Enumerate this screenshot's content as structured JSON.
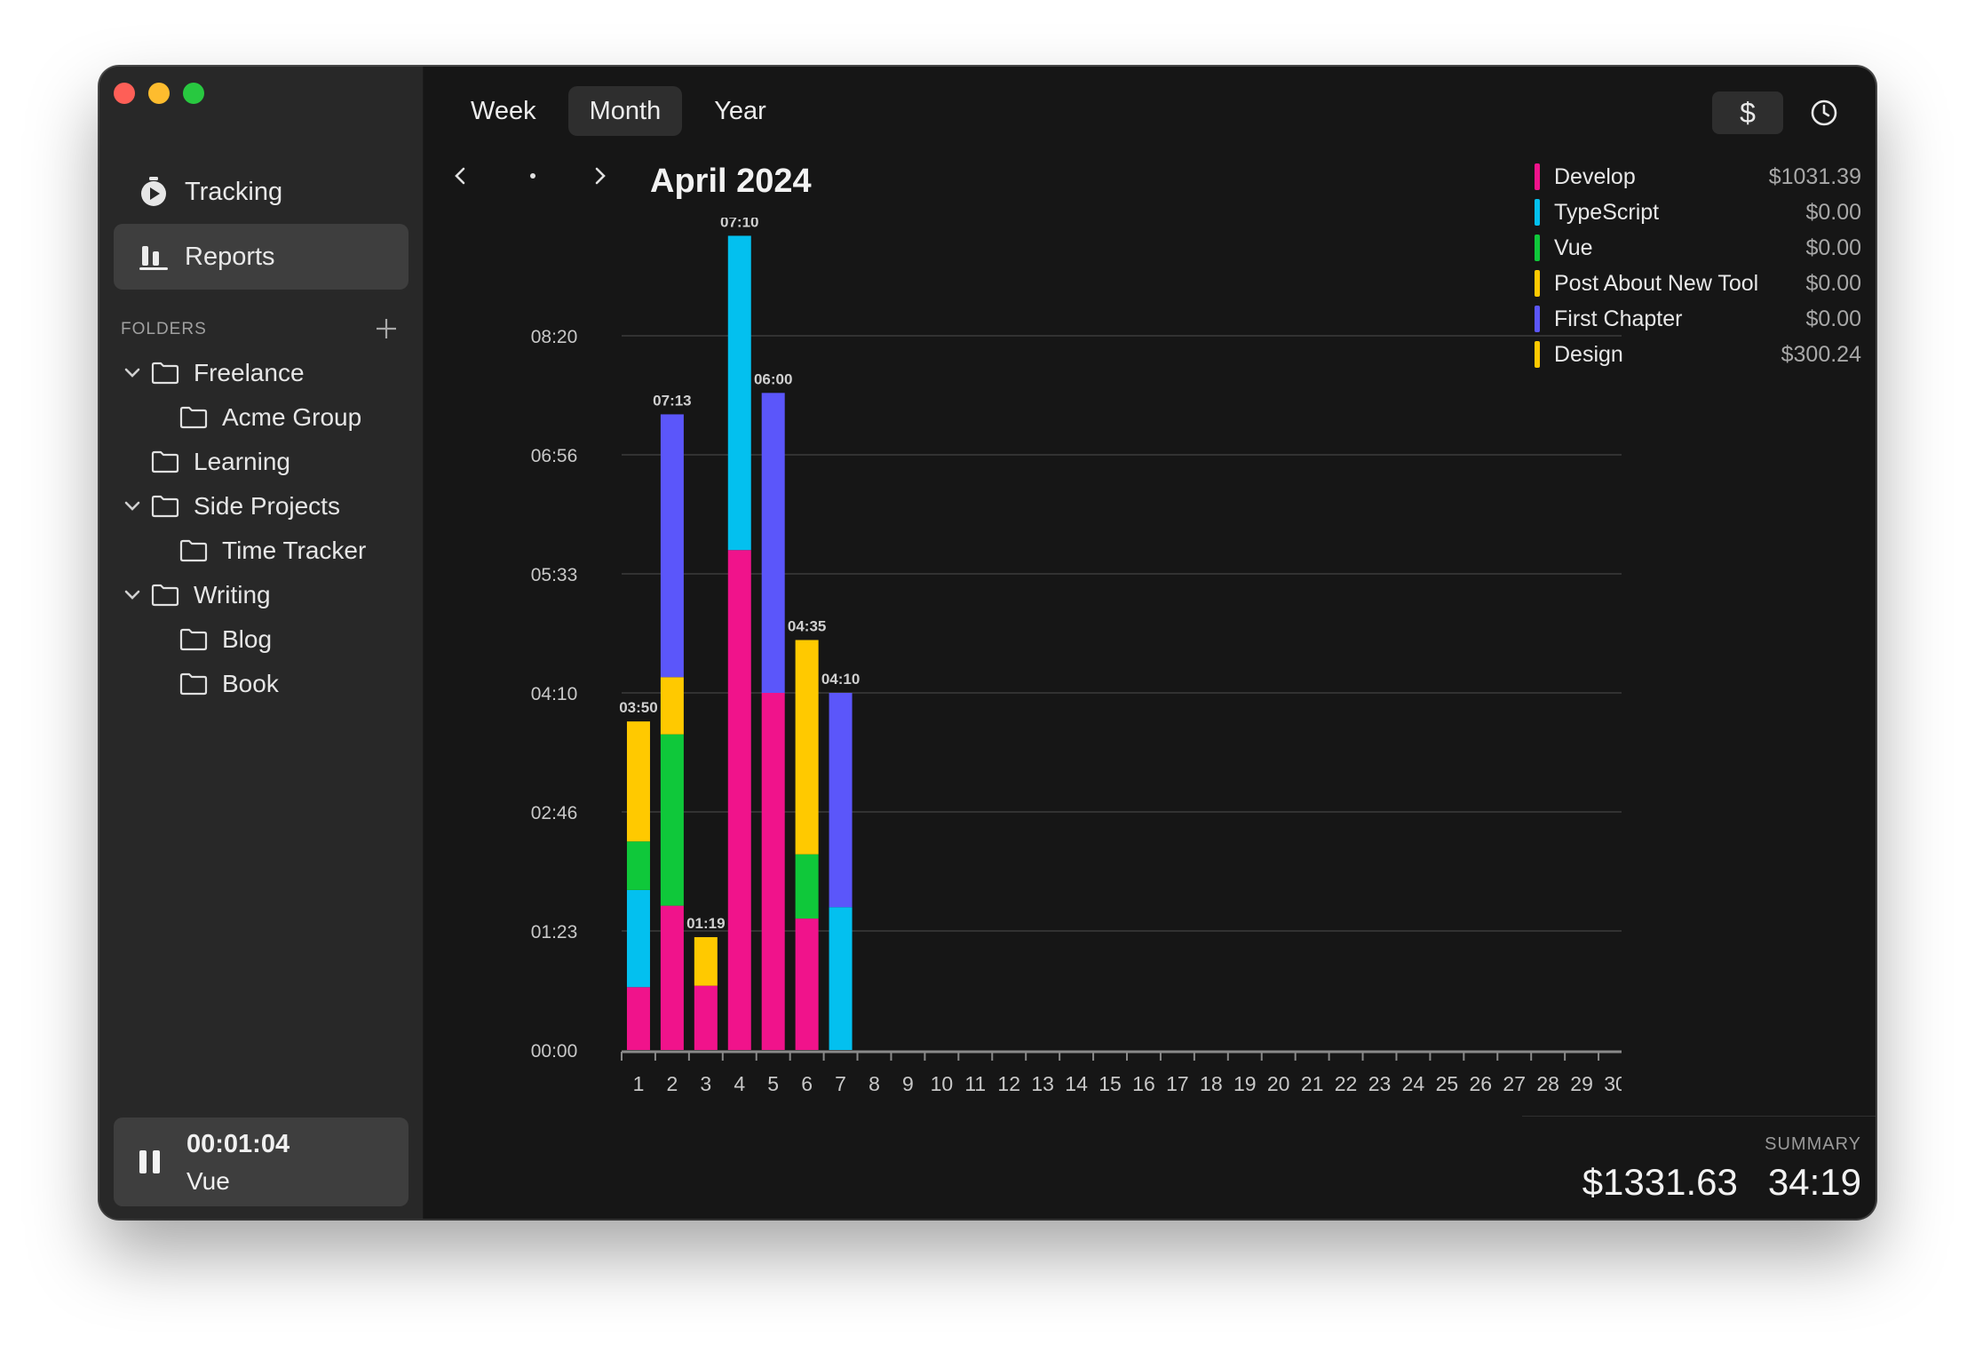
{
  "sidebar": {
    "nav": [
      {
        "label": "Tracking",
        "icon": "stopwatch-icon"
      },
      {
        "label": "Reports",
        "icon": "bar-chart-icon",
        "active": true
      }
    ],
    "folders_title": "FOLDERS",
    "tree": [
      {
        "label": "Freelance",
        "level": 0,
        "expanded": true
      },
      {
        "label": "Acme Group",
        "level": 1
      },
      {
        "label": "Learning",
        "level": 0
      },
      {
        "label": "Side Projects",
        "level": 0,
        "expanded": true
      },
      {
        "label": "Time Tracker",
        "level": 1
      },
      {
        "label": "Writing",
        "level": 0,
        "expanded": true
      },
      {
        "label": "Blog",
        "level": 1
      },
      {
        "label": "Book",
        "level": 1
      }
    ],
    "timer": {
      "time": "00:01:04",
      "project": "Vue"
    }
  },
  "toolbar": {
    "tabs": [
      {
        "label": "Week"
      },
      {
        "label": "Month",
        "active": true
      },
      {
        "label": "Year"
      }
    ],
    "currency_label": "$"
  },
  "period": {
    "title": "April 2024"
  },
  "colors": {
    "develop": "#f0138b",
    "typescript": "#03c0ef",
    "vue": "#0fc83a",
    "post": "#ffc900",
    "chapter": "#5b56fa",
    "design": "#ffc900"
  },
  "legend": [
    {
      "name": "Develop",
      "value": "$1031.39",
      "color": "#f0138b"
    },
    {
      "name": "TypeScript",
      "value": "$0.00",
      "color": "#03c0ef"
    },
    {
      "name": "Vue",
      "value": "$0.00",
      "color": "#0fc83a"
    },
    {
      "name": "Post About New Tool",
      "value": "$0.00",
      "color": "#ffc900"
    },
    {
      "name": "First Chapter",
      "value": "$0.00",
      "color": "#5b56fa"
    },
    {
      "name": "Design",
      "value": "$300.24",
      "color": "#ffc900"
    }
  ],
  "summary": {
    "label": "SUMMARY",
    "amount": "$1331.63",
    "hours": "34:19"
  },
  "chart_data": {
    "type": "bar",
    "stacked": true,
    "y_ticks": [
      "00:00",
      "01:23",
      "02:46",
      "04:10",
      "05:33",
      "06:56",
      "08:20"
    ],
    "ylim": [
      0,
      500
    ],
    "grid": true,
    "categories": [
      "1",
      "2",
      "3",
      "4",
      "5",
      "6",
      "7",
      "8",
      "9",
      "10",
      "11",
      "12",
      "13",
      "14",
      "15",
      "16",
      "17",
      "18",
      "19",
      "20",
      "21",
      "22",
      "23",
      "24",
      "25",
      "26",
      "27",
      "28",
      "29",
      "30"
    ],
    "totals_labels": [
      "03:50",
      "07:13",
      "01:19",
      "07:10",
      "06:00",
      "04:35",
      "04:10",
      "",
      "",
      "",
      "",
      "",
      "",
      "",
      "",
      "",
      "",
      "",
      "",
      "",
      "",
      "",
      "",
      "",
      "",
      "",
      "",
      "",
      "",
      ""
    ],
    "series": [
      {
        "name": "Develop",
        "color": "#f0138b",
        "values": [
          44,
          101,
          45,
          350,
          250,
          92,
          0,
          0,
          0,
          0,
          0,
          0,
          0,
          0,
          0,
          0,
          0,
          0,
          0,
          0,
          0,
          0,
          0,
          0,
          0,
          0,
          0,
          0,
          0,
          0
        ]
      },
      {
        "name": "TypeScript",
        "color": "#03c0ef",
        "values": [
          68,
          0,
          0,
          220,
          0,
          0,
          100,
          0,
          0,
          0,
          0,
          0,
          0,
          0,
          0,
          0,
          0,
          0,
          0,
          0,
          0,
          0,
          0,
          0,
          0,
          0,
          0,
          0,
          0,
          0
        ]
      },
      {
        "name": "Vue",
        "color": "#0fc83a",
        "values": [
          34,
          120,
          0,
          0,
          0,
          45,
          0,
          0,
          0,
          0,
          0,
          0,
          0,
          0,
          0,
          0,
          0,
          0,
          0,
          0,
          0,
          0,
          0,
          0,
          0,
          0,
          0,
          0,
          0,
          0
        ]
      },
      {
        "name": "Post About New Tool",
        "color": "#ffc900",
        "values": [
          84,
          40,
          34,
          0,
          0,
          0,
          0,
          0,
          0,
          0,
          0,
          0,
          0,
          0,
          0,
          0,
          0,
          0,
          0,
          0,
          0,
          0,
          0,
          0,
          0,
          0,
          0,
          0,
          0,
          0
        ]
      },
      {
        "name": "First Chapter",
        "color": "#5b56fa",
        "values": [
          0,
          184,
          0,
          0,
          210,
          0,
          150,
          0,
          0,
          0,
          0,
          0,
          0,
          0,
          0,
          0,
          0,
          0,
          0,
          0,
          0,
          0,
          0,
          0,
          0,
          0,
          0,
          0,
          0,
          0
        ]
      },
      {
        "name": "Design",
        "color": "#ffc900",
        "values": [
          0,
          0,
          0,
          0,
          0,
          150,
          0,
          0,
          0,
          0,
          0,
          0,
          0,
          0,
          0,
          0,
          0,
          0,
          0,
          0,
          0,
          0,
          0,
          0,
          0,
          0,
          0,
          0,
          0,
          0
        ]
      }
    ]
  }
}
